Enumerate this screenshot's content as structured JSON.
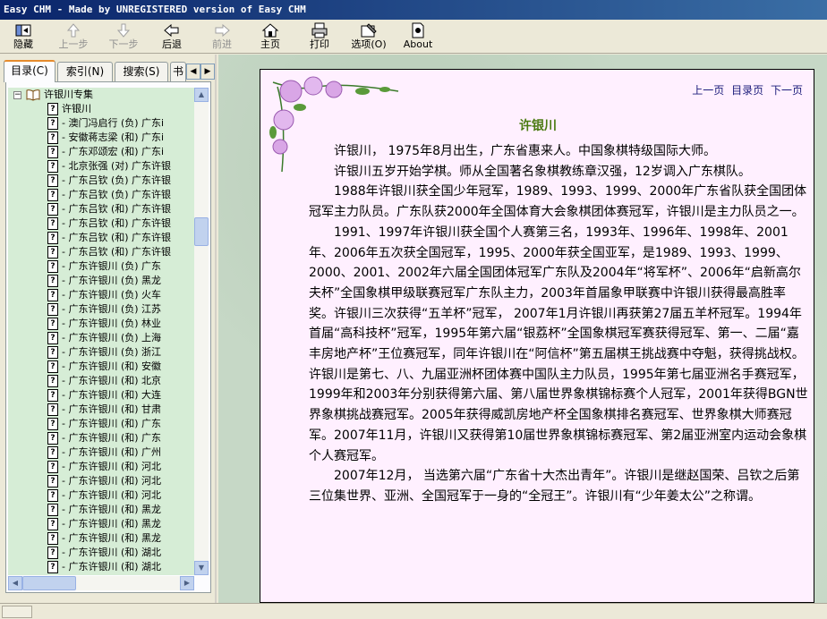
{
  "window": {
    "title": "Easy CHM - Made by UNREGISTERED version of Easy CHM"
  },
  "toolbar": {
    "buttons": [
      {
        "label": "隐藏",
        "icon": "hide-icon",
        "enabled": true
      },
      {
        "label": "上一步",
        "icon": "up-arrow-icon",
        "enabled": false
      },
      {
        "label": "下一步",
        "icon": "down-arrow-icon",
        "enabled": false
      },
      {
        "label": "后退",
        "icon": "back-icon",
        "enabled": true
      },
      {
        "label": "前进",
        "icon": "forward-icon",
        "enabled": false
      },
      {
        "label": "主页",
        "icon": "home-icon",
        "enabled": true
      },
      {
        "label": "打印",
        "icon": "print-icon",
        "enabled": true
      },
      {
        "label": "选项(O)",
        "icon": "options-icon",
        "enabled": true
      },
      {
        "label": "About",
        "icon": "about-icon",
        "enabled": true
      }
    ]
  },
  "tabs": [
    {
      "label": "目录(C)",
      "active": true
    },
    {
      "label": "索引(N)",
      "active": false
    },
    {
      "label": "搜索(S)",
      "active": false
    },
    {
      "label": "书",
      "active": false
    }
  ],
  "tree": {
    "root": "许银川专集",
    "items": [
      "许银川",
      "- 澳门冯启行 (负) 广东i",
      "- 安徽蒋志梁 (和) 广东i",
      "- 广东邓颂宏 (和) 广东i",
      "- 北京张强 (对) 广东许银",
      "- 广东吕钦 (负) 广东许银",
      "- 广东吕钦 (负) 广东许银",
      "- 广东吕钦 (和) 广东许银",
      "- 广东吕钦 (和) 广东许银",
      "- 广东吕钦 (和) 广东许银",
      "- 广东吕钦 (和) 广东许银",
      "- 广东许银川 (负) 广东",
      "- 广东许银川 (负) 黑龙",
      "- 广东许银川 (负) 火车",
      "- 广东许银川 (负) 江苏",
      "- 广东许银川 (负) 林业",
      "- 广东许银川 (负) 上海",
      "- 广东许银川 (负) 浙江",
      "- 广东许银川 (和) 安徽",
      "- 广东许银川 (和) 北京",
      "- 广东许银川 (和) 大连",
      "- 广东许银川 (和) 甘肃",
      "- 广东许银川 (和) 广东",
      "- 广东许银川 (和) 广东",
      "- 广东许银川 (和) 广州",
      "- 广东许银川 (和) 河北",
      "- 广东许银川 (和) 河北",
      "- 广东许银川 (和) 河北",
      "- 广东许银川 (和) 黑龙",
      "- 广东许银川 (和) 黑龙",
      "- 广东许银川 (和) 黑龙",
      "- 广东许银川 (和) 湖北",
      "- 广东许银川 (和) 湖北"
    ]
  },
  "document": {
    "nav": {
      "prev": "上一页",
      "toc": "目录页",
      "next": "下一页"
    },
    "title": "许银川",
    "paragraphs": [
      "许银川，  1975年8月出生，广东省惠来人。中国象棋特级国际大师。",
      "许银川五岁开始学棋。师从全国著名象棋教练章汉强，12岁调入广东棋队。",
      "1988年许银川获全国少年冠军，1989、1993、1999、2000年广东省队获全国团体冠军主力队员。广东队获2000年全国体育大会象棋团体赛冠军，许银川是主力队员之一。",
      "1991、1997年许银川获全国个人赛第三名，1993年、1996年、1998年、2001年、2006年五次获全国冠军，1995、2000年获全国亚军，是1989、1993、1999、2000、2001、2002年六届全国团体冠军广东队及2004年“将军杯”、2006年“启新高尔夫杯”全国象棋甲级联赛冠军广东队主力，2003年首届象甲联赛中许银川获得最高胜率奖。许银川三次获得“五羊杯”冠军， 2007年1月许银川再获第27届五羊杯冠军。1994年首届“高科技杯”冠军，1995年第六届“银荔杯”全国象棋冠军赛获得冠军、第一、二届“嘉丰房地产杯”王位赛冠军，同年许银川在“阿信杯”第五届棋王挑战赛中夺魁，获得挑战权。许银川是第七、八、九届亚洲杯团体赛中国队主力队员，1995年第七届亚洲名手赛冠军，1999年和2003年分别获得第六届、第八届世界象棋锦标赛个人冠军，2001年获得BGN世界象棋挑战赛冠军。2005年获得威凯房地产杯全国象棋排名赛冠军、世界象棋大师赛冠军。2007年11月，许银川又获得第10届世界象棋锦标赛冠军、第2届亚洲室内运动会象棋个人赛冠军。",
      "2007年12月，  当选第六届“广东省十大杰出青年”。许银川是继赵国荣、吕钦之后第三位集世界、亚洲、全国冠军于一身的“全冠王”。许银川有“少年姜太公”之称谓。"
    ]
  },
  "colors": {
    "tree_bg": "#d6edd6",
    "doc_bg": "#fff0ff",
    "title_green": "#4a7a10",
    "pane_bg": "#c6d8c6"
  }
}
